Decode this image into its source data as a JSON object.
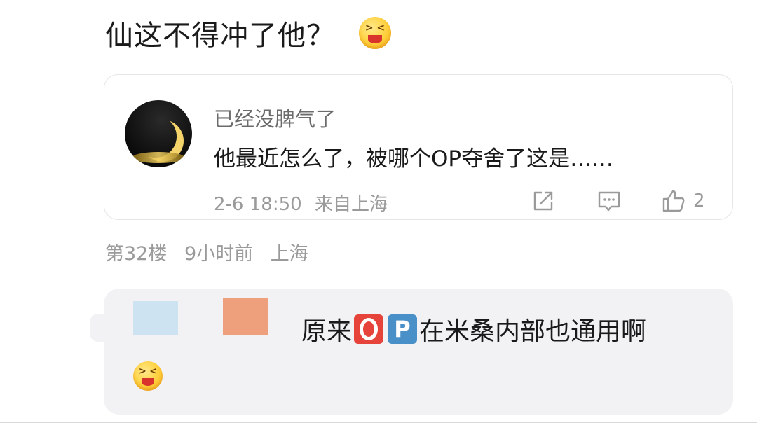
{
  "post": {
    "text": "仙这不得冲了他？",
    "emoji": "grinning-squint-emoji"
  },
  "quote": {
    "username": "已经没脾气了",
    "body": "他最近怎么了，被哪个OP夺舍了这是……",
    "time": "2-6 18:50",
    "location": "来自上海",
    "like_count": "2"
  },
  "floor": {
    "number": "第32楼",
    "time_ago": "9小时前",
    "location": "上海"
  },
  "reply": {
    "text_before": "原来",
    "key_o": "O",
    "key_p": "P",
    "text_after": "在米桑内部也通用啊",
    "emoji": "grinning-squint-emoji"
  },
  "colors": {
    "primary_text": "#1a1a1a",
    "secondary_text": "#9a9a9a",
    "reply_bg": "#f2f2f5",
    "key_o_bg": "#e6443a",
    "key_p_bg": "#4a90c8"
  }
}
